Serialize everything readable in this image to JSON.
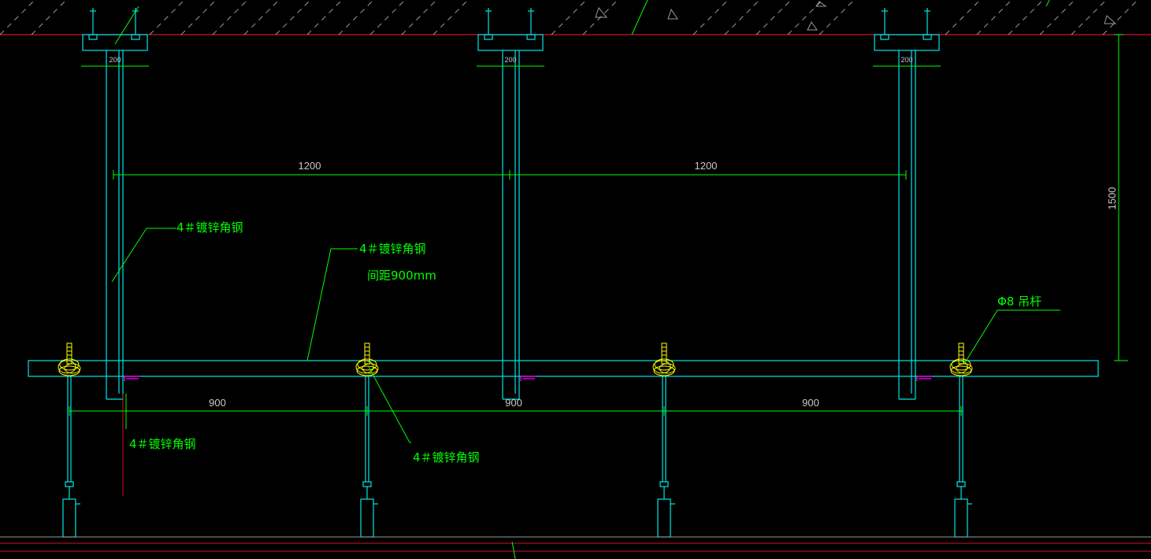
{
  "drawing": {
    "colors": {
      "background": "#000000",
      "members": "#00e5e5",
      "dimension_lines": "#00ff00",
      "dimension_text": "#c8c8c8",
      "labels": "#00ff00",
      "slab_line": "#d01030",
      "rod_ends": "#ffff00",
      "angle_marks": "#ff00ff"
    },
    "dimensions": {
      "top_span_left": "1200",
      "top_span_right": "1200",
      "bottom_span_1": "900",
      "bottom_span_2": "900",
      "bottom_span_3": "900",
      "height": "1500",
      "anchor_widths": [
        "200",
        "200",
        "200"
      ]
    },
    "labels": {
      "upper_angle_steel": "4＃镀锌角钢",
      "main_angle_steel": "4＃镀锌角钢",
      "spacing_note": "间距900mm",
      "hanger_rod": "Φ8 吊杆",
      "lower_left_angle": "4＃镀锌角钢",
      "lower_mid_angle": "4＃镀锌角钢"
    }
  }
}
